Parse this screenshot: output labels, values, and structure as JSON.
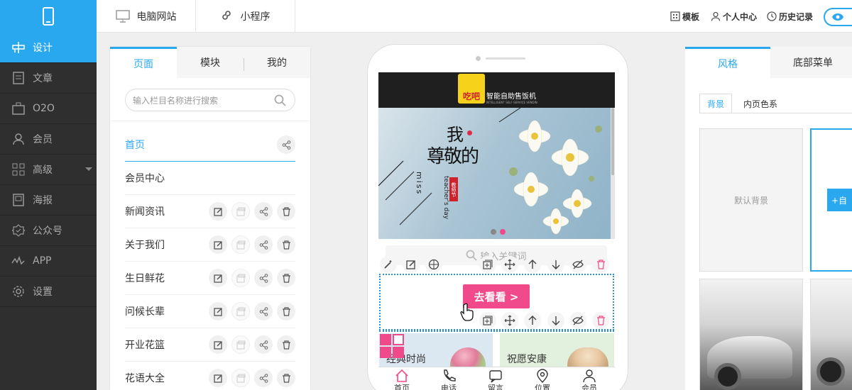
{
  "topbar": {
    "tabs": [
      {
        "label": "电脑网站"
      },
      {
        "label": "小程序"
      }
    ],
    "right": {
      "template": "模板",
      "personal": "个人中心",
      "history": "历史记录"
    }
  },
  "sidebar": {
    "items": [
      {
        "label": "设计",
        "icon": "design-icon",
        "active": true
      },
      {
        "label": "文章",
        "icon": "article-icon"
      },
      {
        "label": "O2O",
        "icon": "o2o-icon"
      },
      {
        "label": "会员",
        "icon": "member-icon"
      },
      {
        "label": "高级",
        "icon": "grid-icon"
      },
      {
        "label": "海报",
        "icon": "poster-icon"
      },
      {
        "label": "公众号",
        "icon": "official-account-icon"
      },
      {
        "label": "APP",
        "icon": "app-icon"
      },
      {
        "label": "设置",
        "icon": "settings-icon"
      }
    ]
  },
  "left_panel": {
    "tabs": [
      {
        "label": "页面"
      },
      {
        "label": "模块"
      },
      {
        "label": "我的"
      }
    ],
    "search_placeholder": "输入栏目名称进行搜索",
    "pages": [
      {
        "label": "首页"
      },
      {
        "label": "会员中心"
      },
      {
        "label": "新闻资讯"
      },
      {
        "label": "关于我们"
      },
      {
        "label": "生日鲜花"
      },
      {
        "label": "问候长辈"
      },
      {
        "label": "开业花篮"
      },
      {
        "label": "花语大全"
      }
    ]
  },
  "phone": {
    "header_brand": "吃吧",
    "header_brand_sub": "智能自助售饭机",
    "header_brand_small": "INTELLIGENT SELF-SERVICE VENDING MACHINE",
    "banner": {
      "t1": "我",
      "t2": "尊敬的",
      "t3": "miss",
      "t4": "teacher's day",
      "t5": "教师节"
    },
    "search_placeholder": "输入关键词",
    "go_button": "去看看 >",
    "product_cards": [
      {
        "label": "经典时尚"
      },
      {
        "label": "祝愿安康"
      }
    ],
    "bottom_nav": [
      {
        "label": "首页"
      },
      {
        "label": "电话"
      },
      {
        "label": "留言"
      },
      {
        "label": "位置"
      },
      {
        "label": "会员"
      }
    ]
  },
  "right_panel": {
    "tabs": [
      {
        "label": "风格"
      },
      {
        "label": "底部菜单"
      }
    ],
    "subtabs": [
      {
        "label": "背景"
      },
      {
        "label": "内页色系"
      }
    ],
    "default_bg": "默认背景",
    "custom_button": "+自"
  },
  "colors": {
    "accent": "#29a8f0",
    "pink": "#f04a8b",
    "sidebar": "#2f2f2f"
  }
}
